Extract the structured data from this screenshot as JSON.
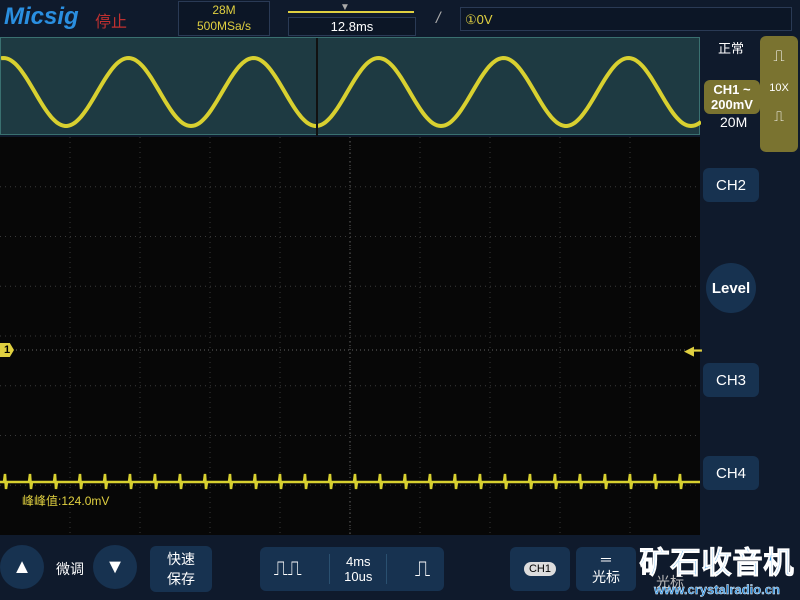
{
  "header": {
    "logo": "Micsig",
    "run_state": "停止",
    "memory_depth": "28M",
    "sample_rate": "500MSa/s",
    "trigger_position": "12.8ms",
    "trigger_edge": "/",
    "trigger_level": "①0V"
  },
  "side": {
    "acq_mode": "正常",
    "ch1_label": "CH1 ~",
    "ch1_scale": "200mV",
    "bandwidth": "20M",
    "probe": "10X",
    "ch2": "CH2",
    "level": "Level",
    "ch3": "CH3",
    "ch4": "CH4"
  },
  "screen": {
    "ch1_marker": "1",
    "measurement": "峰峰值:124.0mV"
  },
  "bottom": {
    "fine_adjust": "微调",
    "quick_save_1": "快速",
    "quick_save_2": "保存",
    "timebase_1": "4ms",
    "timebase_2": "10us",
    "ch1_badge": "CH1",
    "cursor_label": "光标",
    "cursor_label_2": "光标"
  },
  "watermark": {
    "title": "矿石收音机",
    "url": "www.crystalradio.cn"
  },
  "colors": {
    "ch1": "#d8d030",
    "grid": "#3a4a5a",
    "accent": "#7a7330"
  }
}
